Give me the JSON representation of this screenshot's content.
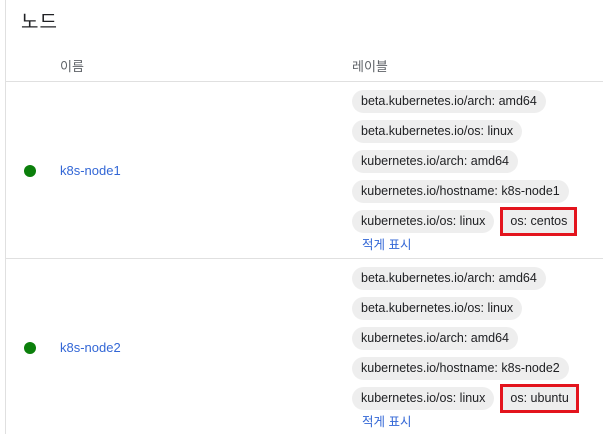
{
  "page": {
    "title": "노드"
  },
  "table": {
    "col_name": "이름",
    "col_labels": "레이블",
    "show_less_label": "적게 표시",
    "status_color": "#0b7f0b",
    "highlight_color": "#e3141d",
    "rows": [
      {
        "name": "k8s-node1",
        "labels": [
          "beta.kubernetes.io/arch: amd64",
          "beta.kubernetes.io/os: linux",
          "kubernetes.io/arch: amd64",
          "kubernetes.io/hostname: k8s-node1",
          "kubernetes.io/os: linux",
          "os: centos"
        ]
      },
      {
        "name": "k8s-node2",
        "labels": [
          "beta.kubernetes.io/arch: amd64",
          "beta.kubernetes.io/os: linux",
          "kubernetes.io/arch: amd64",
          "kubernetes.io/hostname: k8s-node2",
          "kubernetes.io/os: linux",
          "os: ubuntu"
        ]
      }
    ]
  }
}
